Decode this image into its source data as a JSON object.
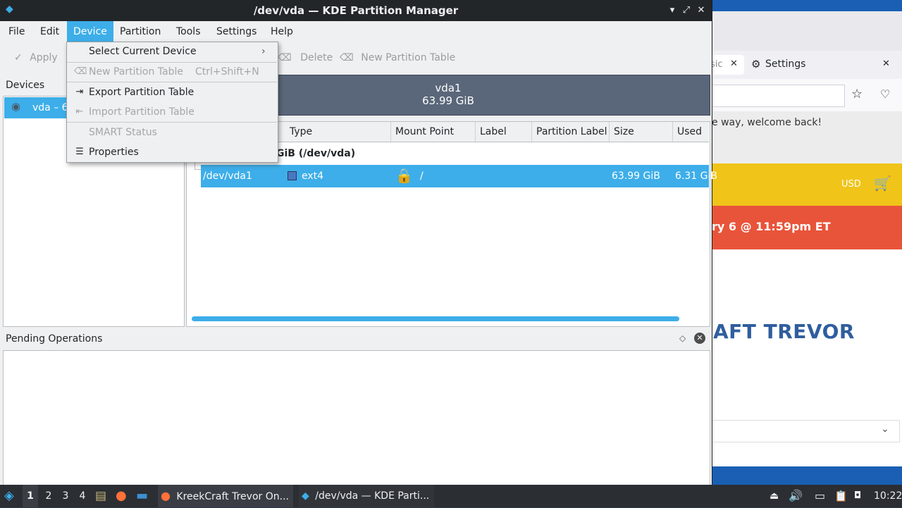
{
  "window": {
    "title": "/dev/vda — KDE Partition Manager",
    "controls": {
      "minimize": "▾",
      "maximize": "⤢",
      "close": "✕"
    }
  },
  "menubar": [
    "File",
    "Edit",
    "Device",
    "Partition",
    "Tools",
    "Settings",
    "Help"
  ],
  "toolbar": {
    "apply": "Apply",
    "delete": "Delete",
    "new_partition_table": "New Partition Table"
  },
  "devices": {
    "header": "Devices",
    "items": [
      "vda – 6"
    ]
  },
  "partition_bar": {
    "name": "vda1",
    "size": "63.99 GiB"
  },
  "table": {
    "columns": [
      "Type",
      "Mount Point",
      "Label",
      "Partition Label",
      "Size",
      "Used"
    ],
    "device_row": "GiB (/dev/vda)",
    "rows": [
      {
        "partition": "/dev/vda1",
        "type": "ext4",
        "mount": "/",
        "label": "",
        "plabel": "",
        "size": "63.99 GiB",
        "used": "6.31 GiB"
      }
    ]
  },
  "pending": {
    "title": "Pending Operations"
  },
  "device_menu": {
    "items": [
      {
        "label": "Select Current Device",
        "shortcut": "",
        "has_submenu": true,
        "disabled": false,
        "icon": ""
      },
      {
        "label": "New Partition Table",
        "shortcut": "Ctrl+Shift+N",
        "disabled": true,
        "icon": "new-partition-table-icon"
      },
      {
        "label": "Export Partition Table",
        "shortcut": "",
        "disabled": false,
        "icon": "export-icon"
      },
      {
        "label": "Import Partition Table",
        "shortcut": "",
        "disabled": true,
        "icon": "import-icon"
      },
      {
        "label": "SMART Status",
        "shortcut": "",
        "disabled": true,
        "icon": ""
      },
      {
        "label": "Properties",
        "shortcut": "",
        "disabled": false,
        "icon": "properties-icon"
      }
    ]
  },
  "browser": {
    "tab_partial": "sic",
    "settings_tab": "Settings",
    "welcome": "e way, welcome back!",
    "currency": "USD",
    "banner": "ry 6 @ 11:59pm ET",
    "brand_partial": "AFT TREVOR"
  },
  "taskbar": {
    "workspaces": [
      "1",
      "2",
      "3",
      "4"
    ],
    "tasks": [
      "KreekCraft Trevor On...",
      "/dev/vda — KDE Parti..."
    ],
    "clock": "10:22"
  }
}
